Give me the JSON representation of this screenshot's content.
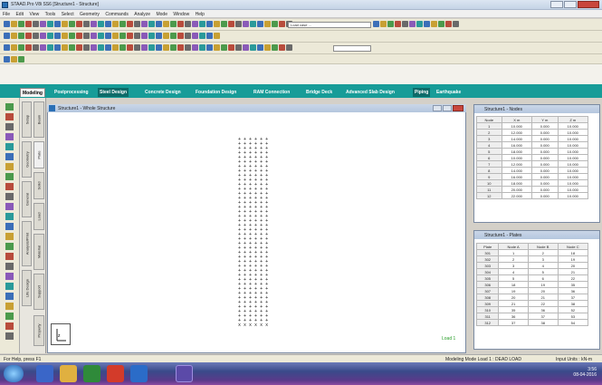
{
  "window": {
    "title": "STAAD.Pro V8i SS6 [Structure1 - Structure]"
  },
  "menu": [
    "File",
    "Edit",
    "View",
    "Tools",
    "Select",
    "Geometry",
    "Commands",
    "Analyze",
    "Mode",
    "Window",
    "Help"
  ],
  "toolbar": {
    "combo1": "Load case ...",
    "combo2": ""
  },
  "tabs": [
    "Modeling",
    "Postprocessing",
    "Steel Design",
    "Concrete Design",
    "Foundation Design",
    "RAM Connection",
    "Bridge Deck",
    "Advanced Slab Design",
    "Piping",
    "Earthquake"
  ],
  "viewport": {
    "title": "Structure1 - Whole Structure",
    "load_label": "Load 1"
  },
  "grid_row": "+ + + + + +",
  "grid_base": "x x x x x x",
  "nodes_panel": {
    "title": "Structure1 - Nodes",
    "headers": [
      "Node",
      "X m",
      "Y m",
      "Z m"
    ],
    "rows": [
      [
        "1",
        "10.000",
        "0.000",
        "10.000"
      ],
      [
        "2",
        "12.000",
        "0.000",
        "10.000"
      ],
      [
        "3",
        "14.000",
        "0.000",
        "10.000"
      ],
      [
        "4",
        "16.000",
        "0.000",
        "10.000"
      ],
      [
        "5",
        "18.000",
        "0.000",
        "10.000"
      ],
      [
        "6",
        "10.000",
        "0.000",
        "10.000"
      ],
      [
        "7",
        "12.000",
        "0.000",
        "10.000"
      ],
      [
        "8",
        "14.000",
        "0.000",
        "10.000"
      ],
      [
        "9",
        "16.000",
        "0.000",
        "10.000"
      ],
      [
        "10",
        "18.000",
        "0.000",
        "10.000"
      ],
      [
        "11",
        "20.000",
        "0.000",
        "10.000"
      ],
      [
        "12",
        "22.000",
        "0.000",
        "10.000"
      ]
    ]
  },
  "plates_panel": {
    "title": "Structure1 - Plates",
    "headers": [
      "Plate",
      "Node A",
      "Node B",
      "Node C"
    ],
    "rows": [
      [
        "301",
        "1",
        "2",
        "18"
      ],
      [
        "302",
        "2",
        "3",
        "19"
      ],
      [
        "303",
        "3",
        "4",
        "20"
      ],
      [
        "304",
        "4",
        "5",
        "21"
      ],
      [
        "305",
        "5",
        "6",
        "22"
      ],
      [
        "306",
        "18",
        "19",
        "35"
      ],
      [
        "307",
        "19",
        "20",
        "36"
      ],
      [
        "308",
        "20",
        "21",
        "37"
      ],
      [
        "309",
        "21",
        "22",
        "38"
      ],
      [
        "310",
        "35",
        "36",
        "52"
      ],
      [
        "311",
        "36",
        "37",
        "53"
      ],
      [
        "312",
        "37",
        "38",
        "54"
      ]
    ]
  },
  "status": {
    "left": "For Help, press F1",
    "mid": "Modeling Mode  Load 1 : DEAD LOAD",
    "right": "Input Units : kN-m"
  },
  "clock": {
    "time": "3:56",
    "date": "08-04-2016"
  },
  "colors": {
    "tab_bar": "#179c98",
    "taskbar": "#3a4a8a",
    "load_label": "#2ca02c"
  }
}
